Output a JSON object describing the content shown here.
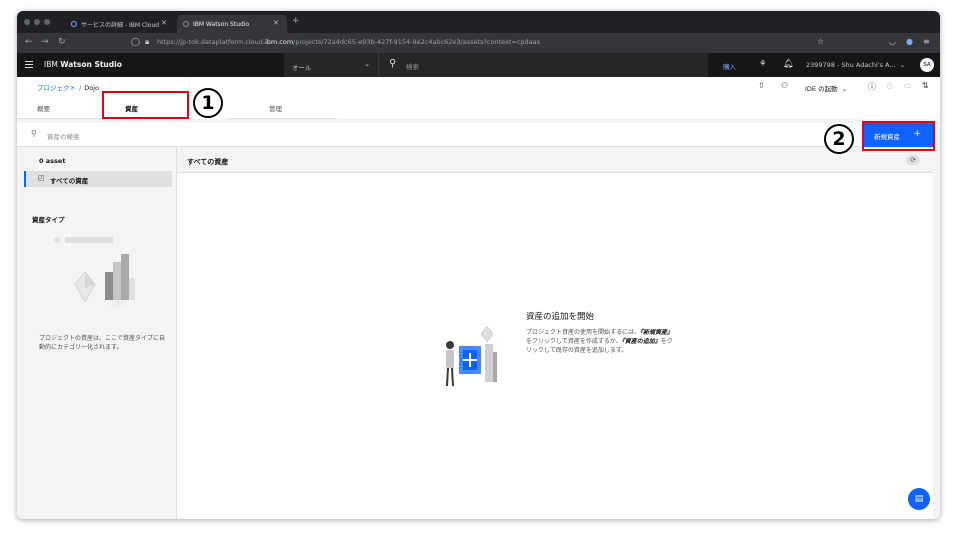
{
  "browser": {
    "tabs": [
      {
        "label": "サービスの詳細 - IBM Cloud",
        "active": false
      },
      {
        "label": "IBM Watson Studio",
        "active": true
      }
    ],
    "url_prefix": "https://jp-tok.dataplatform.cloud.",
    "url_domain": "ibm.com",
    "url_rest": "/projects/72a4dc65-e93b-427f-9154-9e2c4abc62e3/assets?context=cpdaas"
  },
  "header": {
    "brand_prefix": "IBM",
    "brand_product": "Watson Studio",
    "scope": "オール",
    "search_placeholder": "検索",
    "buy_label": "購入",
    "account": "2399798 - Shu Adachi's A...",
    "avatar_initials": "SA"
  },
  "breadcrumb": {
    "root": "プロジェクト",
    "separator": "/",
    "current": "Dojo"
  },
  "toolbar": {
    "ide_label": "IDE の起動"
  },
  "page_tabs": [
    {
      "label": "概要",
      "active": false
    },
    {
      "label": "資産",
      "active": true
    },
    {
      "label": "管理",
      "active": false
    }
  ],
  "search": {
    "placeholder": "資産の検索"
  },
  "new_asset_label": "新規資産",
  "sidebar": {
    "count": "0 asset",
    "all_assets": "すべての資産",
    "types_heading": "資産タイプ",
    "empty_text": "プロジェクトの資産は、ここで資産タイプに自動的にカテゴリー化されます。"
  },
  "main": {
    "heading": "すべての資産",
    "empty_title": "資産の追加を開始",
    "empty_desc_1": "プロジェクト資産の使用を開始するには、",
    "empty_desc_new": "『新規資産』",
    "empty_desc_2": "をクリックして資産を作成するか、",
    "empty_desc_add": "『資産の追加』",
    "empty_desc_3": "をクリックして既存の資産を追加します。"
  },
  "annotations": {
    "marker_1": "1",
    "marker_2": "2",
    "color": "#e3000f"
  }
}
